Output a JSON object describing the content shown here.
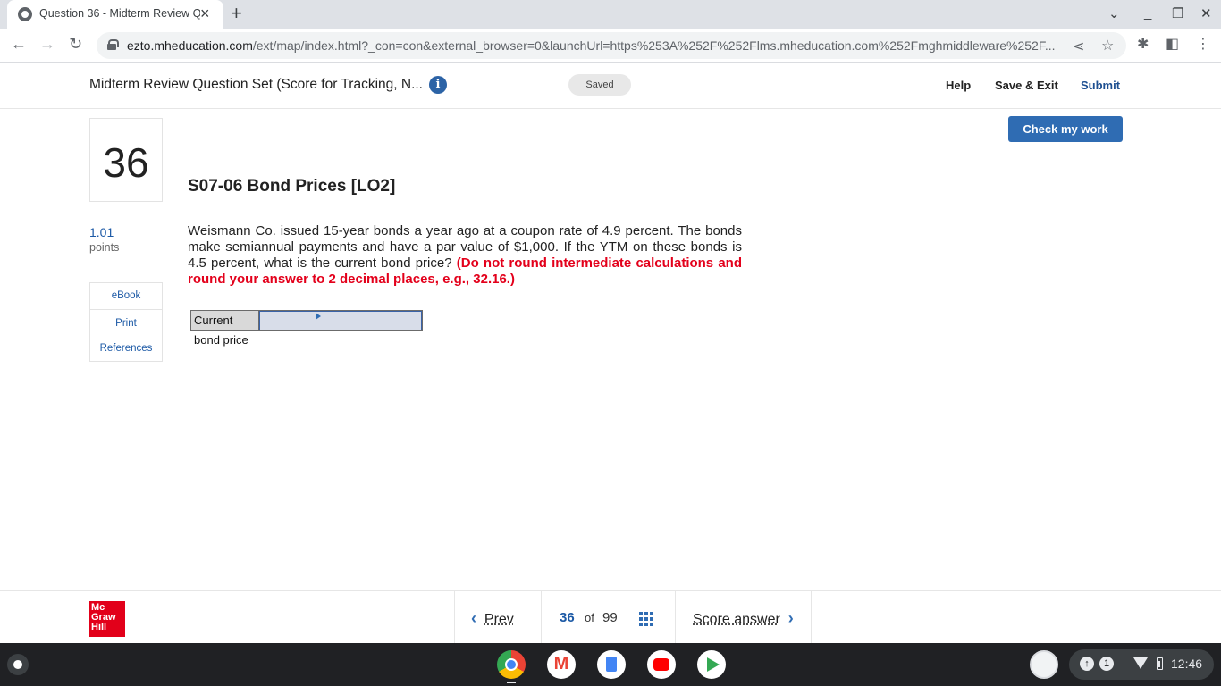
{
  "browser": {
    "tab_title": "Question 36 - Midterm Review Qu",
    "new_tab_label": "+",
    "url_host": "ezto.mheducation.com",
    "url_rest": "/ext/map/index.html?_con=con&external_browser=0&launchUrl=https%253A%252F%252Flms.mheducation.com%252Fmghmiddleware%252F..."
  },
  "header": {
    "assignment_title": "Midterm Review Question Set (Score for Tracking, N...",
    "saved_label": "Saved",
    "help_label": "Help",
    "save_exit_label": "Save & Exit",
    "submit_label": "Submit",
    "info_glyph": "i"
  },
  "question": {
    "number": "36",
    "points_value": "1.01",
    "points_label": "points",
    "title": "S07-06 Bond Prices [LO2]",
    "body_text": "Weismann Co. issued 15-year bonds a year ago at a coupon rate of 4.9 percent. The bonds make semiannual payments and have a par value of $1,000. If the YTM on these bonds is 4.5 percent, what is the current bond price? ",
    "instruction_text": "(Do not round intermediate calculations and round your answer to 2 decimal places, e.g., 32.16.)",
    "answer_label": "Current bond price",
    "answer_value": ""
  },
  "tools": {
    "ebook": "eBook",
    "print": "Print",
    "references": "References"
  },
  "check_button_label": "Check my work",
  "footer": {
    "logo_line1": "Mc",
    "logo_line2": "Graw",
    "logo_line3": "Hill",
    "prev_label": "Prev",
    "current_page": "36",
    "of_label": "of",
    "total_pages": "99",
    "next_label": "Score answer"
  },
  "shelf": {
    "notification_count": "1",
    "time": "12:46"
  },
  "colors": {
    "brand_blue": "#2f6cb3",
    "link_blue": "#1d5aa6",
    "instruction_red": "#e3001b",
    "logo_red": "#e2001a"
  }
}
